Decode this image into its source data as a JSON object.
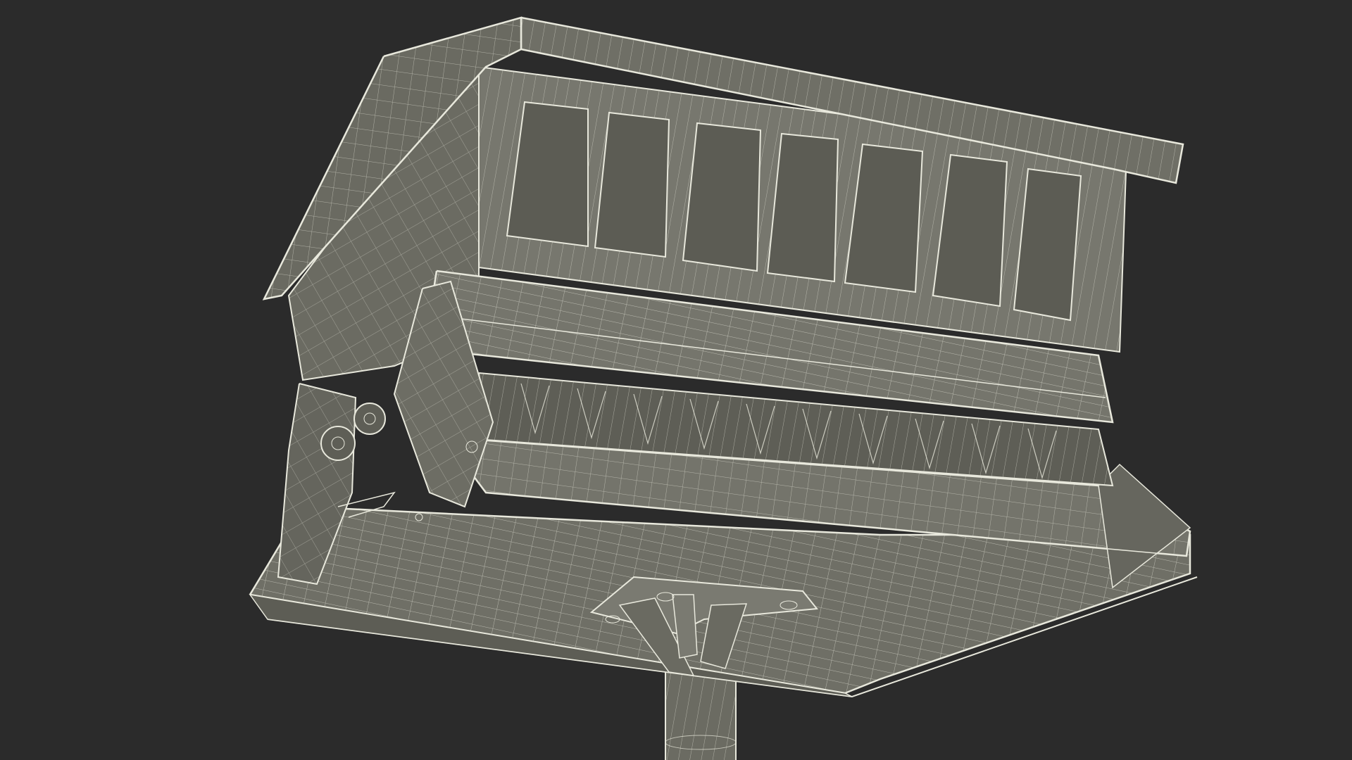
{
  "scene": {
    "subject": "bird-feeder-wireframe-render",
    "colors": {
      "background": "#2b2b2b",
      "body": "#6b6b62",
      "body_dark": "#55554d",
      "panel": "#77776e",
      "window": "#5f5f57",
      "wire": "#e8e8dc"
    }
  }
}
